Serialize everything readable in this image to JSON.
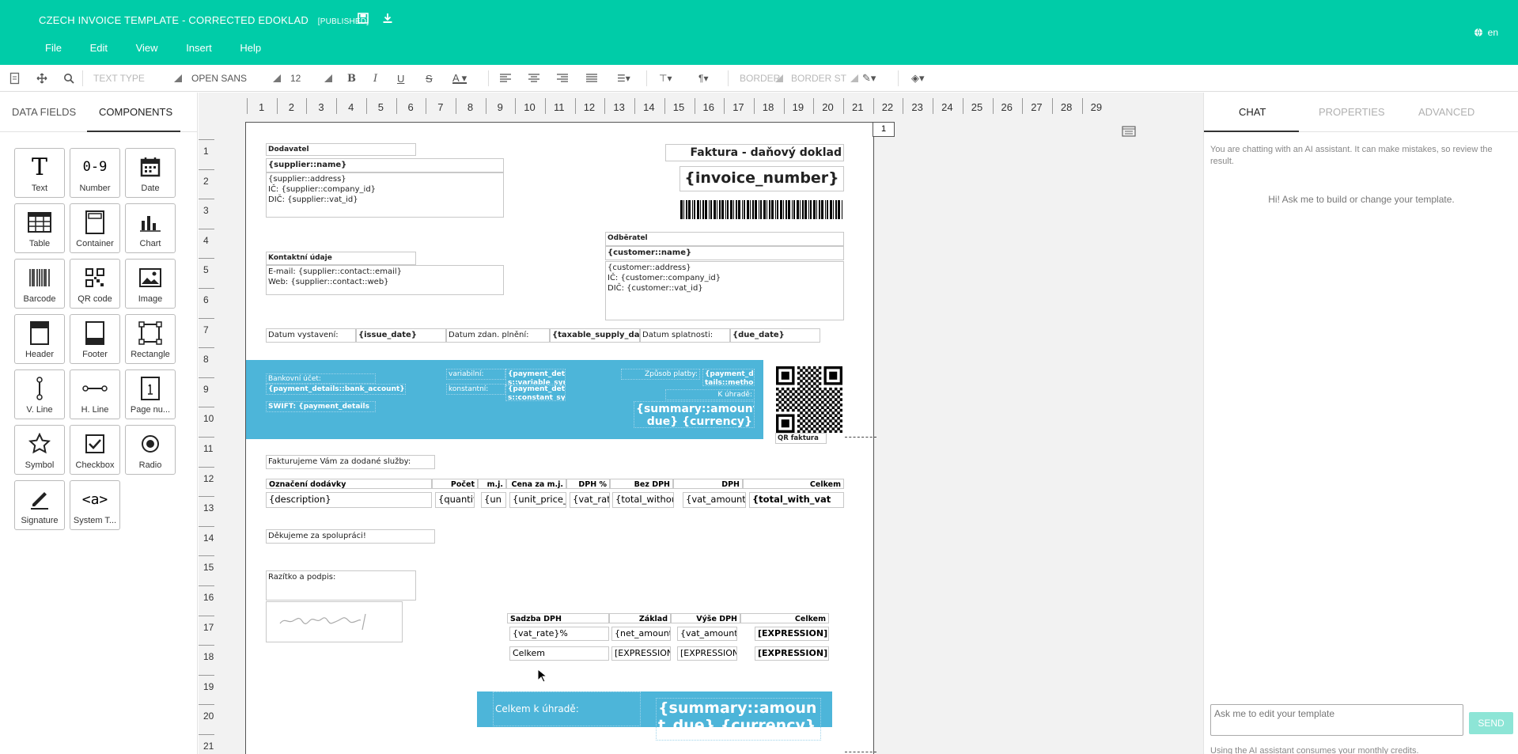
{
  "app": {
    "title": "CZECH INVOICE TEMPLATE - CORRECTED EDOKLAD",
    "badge": "[PUBLISHED]",
    "lang": "en",
    "accent": "#00cca8"
  },
  "menu": [
    "File",
    "Edit",
    "View",
    "Insert",
    "Help"
  ],
  "toolbar": {
    "text_type": "TEXT TYPE",
    "font": "OPEN SANS",
    "size": "12",
    "border": "BORDER",
    "border_style": "BORDER ST"
  },
  "left_panel": {
    "tabs": [
      "DATA FIELDS",
      "COMPONENTS"
    ],
    "components": [
      "Text",
      "Number",
      "Date",
      "Table",
      "Container",
      "Chart",
      "Barcode",
      "QR code",
      "Image",
      "Header",
      "Footer",
      "Rectangle",
      "V. Line",
      "H. Line",
      "Page nu...",
      "Symbol",
      "Checkbox",
      "Radio",
      "Signature",
      "System T..."
    ]
  },
  "rulers": {
    "h": [
      "1",
      "2",
      "3",
      "4",
      "5",
      "6",
      "7",
      "8",
      "9",
      "10",
      "11",
      "12",
      "13",
      "14",
      "15",
      "16",
      "17",
      "18",
      "19",
      "20",
      "21",
      "22",
      "23",
      "24",
      "25",
      "26",
      "27",
      "28",
      "29"
    ],
    "v": [
      "1",
      "2",
      "3",
      "4",
      "5",
      "6",
      "7",
      "8",
      "9",
      "10",
      "11",
      "12",
      "13",
      "14",
      "15",
      "16",
      "17",
      "18",
      "19",
      "20",
      "21"
    ]
  },
  "page_number": "1",
  "invoice": {
    "supplier_label": "Dodavatel",
    "supplier_name": "{supplier::name}",
    "supplier_block": "{supplier::address}\nIČ: {supplier::company_id}\nDIČ: {supplier::vat_id}",
    "doc_title": "Faktura - daňový doklad",
    "invoice_number": "{invoice_number}",
    "customer_label": "Odběratel",
    "customer_name": "{customer::name}",
    "customer_block": "{customer::address}\nIČ: {customer::company_id}\nDIČ: {customer::vat_id}",
    "contact_label": "Kontaktní údaje",
    "contact_block": "E-mail: {supplier::contact::email}\nWeb: {supplier::contact::web}",
    "issue_label": "Datum vystavení:",
    "issue_value": "{issue_date}",
    "taxable_label": "Datum zdan. plnění:",
    "taxable_value": "{taxable_supply_date}",
    "due_label": "Datum splatnosti:",
    "due_value": "{due_date}",
    "bank_label": "Bankovní účet:",
    "bank_value": "{payment_details::bank_account}",
    "swift_value": "SWIFT: {payment_details",
    "variable_label": "variabilní:",
    "variable_value": "{payment_detail\ns::variable_sym",
    "constant_label": "konstantní:",
    "constant_value": "{payment_detail\ns::constant_sym",
    "method_label": "Způsob platby:",
    "method_value": "{payment_de\ntails::method",
    "due_amount_label": "K úhradě:",
    "due_amount_value": "{summary::amount_\ndue} {currency}",
    "qr_label": "QR faktura",
    "intro_text": "Fakturujeme Vám za dodané služby:",
    "items_headers": [
      "Označení dodávky",
      "Počet",
      "m.j.",
      "Cena za m.j.",
      "DPH %",
      "Bez DPH",
      "DPH",
      "Celkem"
    ],
    "items_row": [
      "{description}",
      "{quantit",
      "{un",
      "{unit_price_",
      "{vat_rate",
      "{total_withou",
      "{vat_amount}",
      "{total_with_vat"
    ],
    "thanks": "Děkujeme za spolupráci!",
    "stamp_label": "Razítko a podpis:",
    "vat_headers": [
      "Sadzba DPH",
      "Základ",
      "Výše DPH",
      "Celkem"
    ],
    "vat_row": [
      "{vat_rate}%",
      "{net_amount",
      "{vat_amount}",
      "[EXPRESSION]"
    ],
    "vat_total": [
      "Celkem",
      "[EXPRESSION",
      "[EXPRESSION",
      "[EXPRESSION]"
    ],
    "total_label": "Celkem k úhradě:",
    "total_value": "{summary::amoun\nt_due} {currency}"
  },
  "right_panel": {
    "tabs": [
      "CHAT",
      "PROPERTIES",
      "ADVANCED"
    ],
    "warning": "You are chatting with an AI assistant. It can make mistakes, so review the result.",
    "greeting": "Hi! Ask me to build or change your template.",
    "input_placeholder": "Ask me to edit your template",
    "send_label": "SEND",
    "credits_note": "Using the AI assistant consumes your monthly credits."
  }
}
